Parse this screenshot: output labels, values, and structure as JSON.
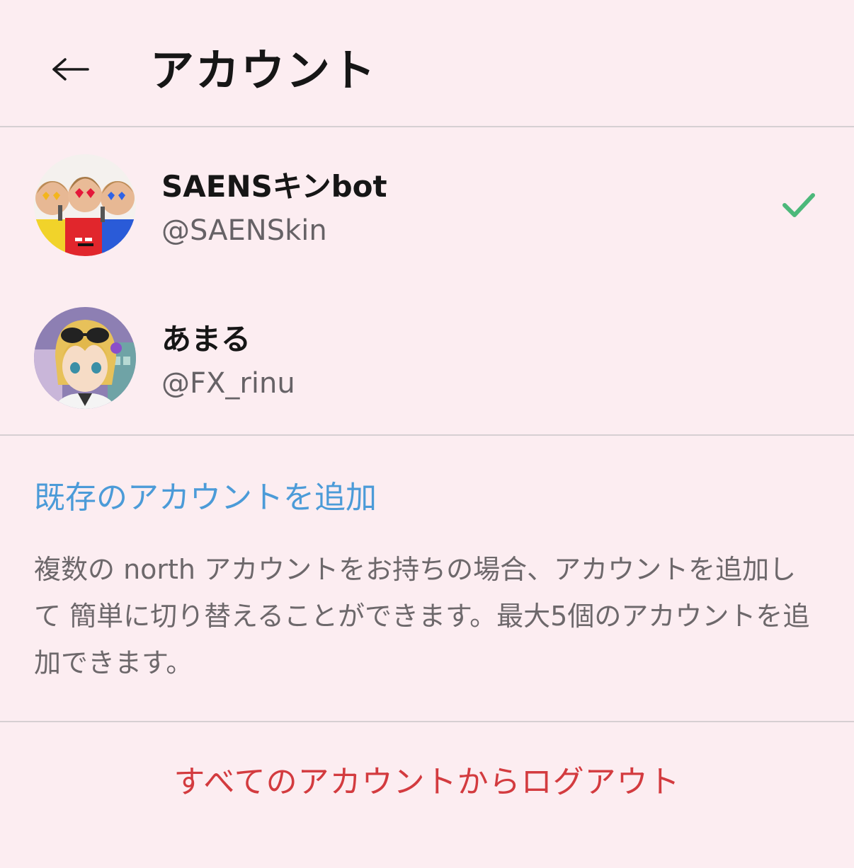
{
  "header": {
    "back_icon": "arrow-left-icon",
    "title": "アカウント"
  },
  "accounts": [
    {
      "name": "SAENSキンbot",
      "handle": "@SAENSkin",
      "selected": true
    },
    {
      "name": "あまる",
      "handle": "@FX_rinu",
      "selected": false
    }
  ],
  "add_existing_label": "既存のアカウントを追加",
  "help_text": "複数の north アカウントをお持ちの場合、アカウントを追加して 簡単に切り替えることができます。最大5個のアカウントを追加できます。",
  "logout_all_label": "すべてのアカウントからログアウト",
  "colors": {
    "background": "#fcedf1",
    "link": "#4b9bd8",
    "danger": "#d33b3f",
    "check": "#4cb87a",
    "divider": "#d6cfd2"
  }
}
